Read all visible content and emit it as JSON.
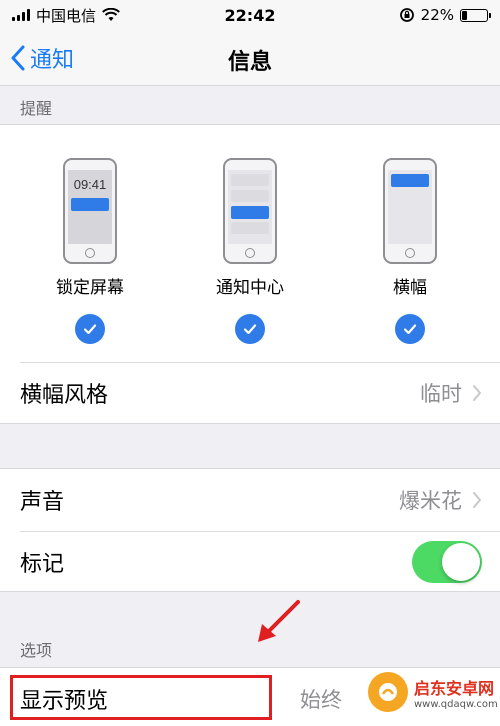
{
  "status_bar": {
    "carrier": "中国电信",
    "time": "22:42",
    "battery": "22%",
    "battery_level": 0.22
  },
  "nav": {
    "back_label": "通知",
    "title": "信息"
  },
  "alerts": {
    "section_label": "提醒",
    "lock_time": "09:41",
    "options": [
      {
        "label": "锁定屏幕",
        "checked": true
      },
      {
        "label": "通知中心",
        "checked": true
      },
      {
        "label": "横幅",
        "checked": true
      }
    ]
  },
  "banner_style": {
    "label": "横幅风格",
    "value": "临时"
  },
  "sound": {
    "label": "声音",
    "value": "爆米花"
  },
  "badge": {
    "label": "标记",
    "on": true
  },
  "options": {
    "section_label": "选项",
    "preview": {
      "label": "显示预览",
      "value": "始终"
    }
  },
  "watermark": {
    "title": "启东安卓网",
    "url": "www.qdaqw.com"
  },
  "colors": {
    "accent": "#1a7cf5",
    "toggle_on": "#4cd964",
    "highlight": "#e02020"
  }
}
